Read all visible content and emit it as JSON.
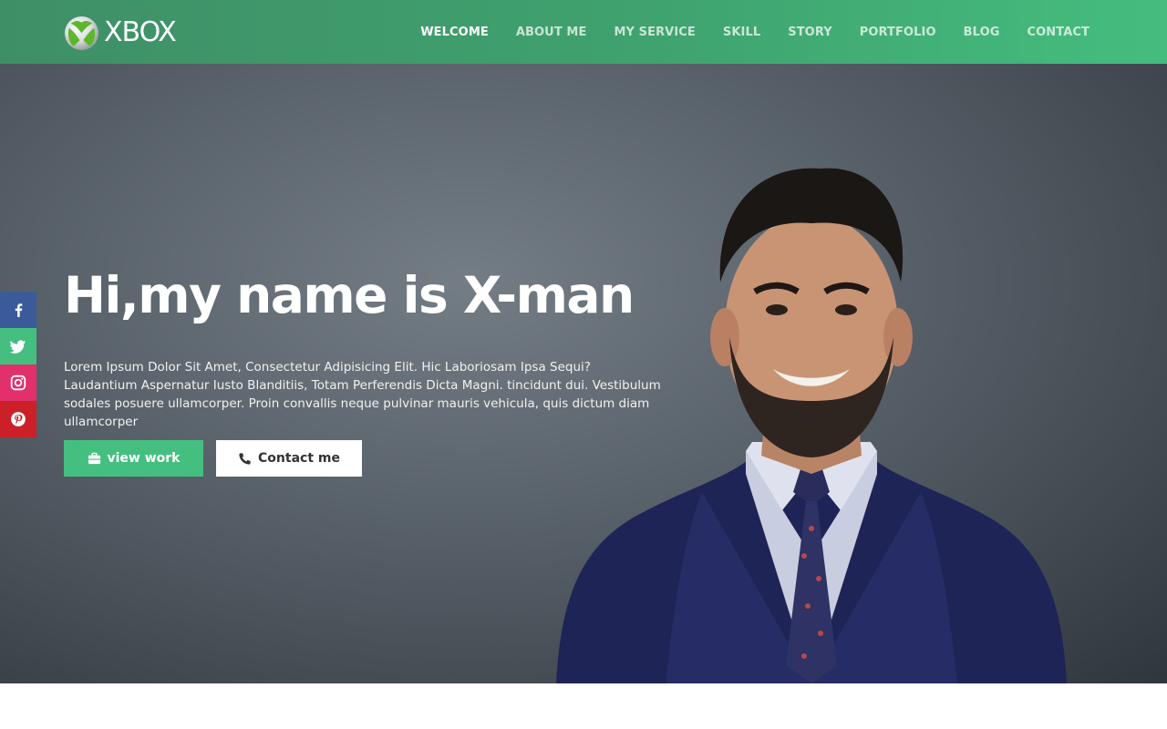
{
  "brand": {
    "logo_text": "XBOX",
    "logo_icon": "xbox-sphere-icon"
  },
  "nav": {
    "items": [
      {
        "label": "WELCOME",
        "active": true
      },
      {
        "label": "ABOUT ME",
        "active": false
      },
      {
        "label": "MY SERVICE",
        "active": false
      },
      {
        "label": "SKILL",
        "active": false
      },
      {
        "label": "STORY",
        "active": false
      },
      {
        "label": "PORTFOLIO",
        "active": false
      },
      {
        "label": "BLOG",
        "active": false
      },
      {
        "label": "CONTACT",
        "active": false
      }
    ]
  },
  "hero": {
    "title": "Hi,my name is X-man",
    "description": "Lorem Ipsum Dolor Sit Amet, Consectetur Adipisicing Elit. Hic Laboriosam Ipsa Sequi? Laudantium Aspernatur Iusto Blanditiis, Totam Perferendis Dicta Magni. tincidunt dui. Vestibulum sodales posuere ullamcorper. Proin convallis neque pulvinar mauris vehicula, quis dictum diam ullamcorper",
    "primary_button": {
      "label": "view work",
      "icon": "briefcase-icon"
    },
    "secondary_button": {
      "label": "Contact me",
      "icon": "phone-icon"
    }
  },
  "social": [
    {
      "network": "facebook",
      "icon": "facebook-icon",
      "color": "#3b5a9a"
    },
    {
      "network": "twitter",
      "icon": "twitter-icon",
      "color": "#45bf80"
    },
    {
      "network": "instagram",
      "icon": "instagram-icon",
      "color": "#e1306c"
    },
    {
      "network": "pinterest",
      "icon": "pinterest-icon",
      "color": "#cb2027"
    }
  ],
  "colors": {
    "header_start": "#3f8f66",
    "header_end": "#45bd7e",
    "accent": "#45bf80",
    "hero_bg": "#5a636b"
  }
}
